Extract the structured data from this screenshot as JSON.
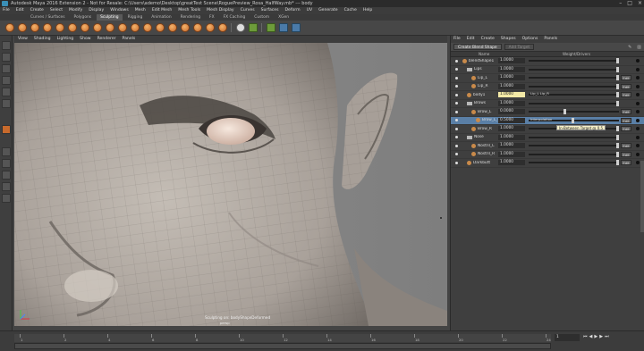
{
  "window": {
    "title": "Autodesk Maya 2016 Extension 2 - Not for Resale: C:\\Users\\ademo\\Desktop\\greatTest Scene\\RoguePreview_Rosa_HalfWay.mb* --- body"
  },
  "menubar": [
    "File",
    "Edit",
    "Create",
    "Select",
    "Modify",
    "Display",
    "Windows",
    "Mesh",
    "Edit Mesh",
    "Mesh Tools",
    "Mesh Display",
    "Curves",
    "Surfaces",
    "Deform",
    "UV",
    "Generate",
    "Cache",
    "Help"
  ],
  "shelf_tabs": {
    "items": [
      "Curves / Surfaces",
      "Polygons",
      "Sculpting",
      "Rigging",
      "Animation",
      "Rendering",
      "FX",
      "FX Caching",
      "Custom",
      "XGen"
    ],
    "active": "Sculpting"
  },
  "viewport": {
    "menu": [
      "View",
      "Shading",
      "Lighting",
      "Show",
      "Renderer",
      "Panels"
    ],
    "caption": "Sculpting on: bodyShapeDeformed",
    "camera": "persp"
  },
  "blend_panel": {
    "menu": [
      "File",
      "Edit",
      "Create",
      "Shapes",
      "Options",
      "Panels"
    ],
    "create_button": "Create Blend Shape",
    "add_target_button": "Add Target",
    "columns": [
      "Name",
      "Weight/Drivers"
    ],
    "edit_label": "Edit",
    "rows": [
      {
        "name": "blendShape1",
        "weight": "1.0000",
        "type": "node",
        "indent": 0,
        "fill": 1.0,
        "edit": false
      },
      {
        "name": "Lips",
        "weight": "1.0000",
        "type": "folder",
        "indent": 1,
        "fill": 1.0,
        "edit": false
      },
      {
        "name": "Lip_L",
        "weight": "1.0000",
        "type": "target",
        "indent": 2,
        "fill": 1.0,
        "edit": true
      },
      {
        "name": "Lip_R",
        "weight": "1.0000",
        "type": "target",
        "indent": 2,
        "fill": 1.0,
        "edit": true
      },
      {
        "name": "body1",
        "weight": "1.0000",
        "type": "target",
        "indent": 1,
        "fill": 1.0,
        "edit": true,
        "highlight": true,
        "extra": "Lip_L Lip_R"
      },
      {
        "name": "Brows",
        "weight": "1.0000",
        "type": "folder",
        "indent": 1,
        "fill": 1.0,
        "edit": false
      },
      {
        "name": "Brow_L",
        "weight": "0.0000",
        "type": "target",
        "indent": 2,
        "fill": 0.42,
        "edit": true
      },
      {
        "name": "Brow_L_0.5",
        "weight": "0.5000",
        "type": "target",
        "indent": 3,
        "fill": 0.5,
        "edit": true,
        "selected": true,
        "extra": "Interpolation"
      },
      {
        "name": "Brow_R",
        "weight": "1.0000",
        "type": "target",
        "indent": 2,
        "fill": 1.0,
        "edit": true
      },
      {
        "name": "Nose",
        "weight": "1.0000",
        "type": "folder",
        "indent": 1,
        "fill": 1.0,
        "edit": false
      },
      {
        "name": "Nostril_L",
        "weight": "1.0000",
        "type": "target",
        "indent": 2,
        "fill": 1.0,
        "edit": true
      },
      {
        "name": "Nostril_R",
        "weight": "1.0000",
        "type": "target",
        "indent": 2,
        "fill": 1.0,
        "edit": true
      },
      {
        "name": "Darkbutt",
        "weight": "1.0000",
        "type": "target",
        "indent": 1,
        "fill": 1.0,
        "edit": true
      }
    ],
    "tooltip": "In-Between Target @ 0.5"
  },
  "timeslider": {
    "ticks": [
      "1",
      "2",
      "4",
      "6",
      "8",
      "10",
      "12",
      "14",
      "16",
      "18",
      "20",
      "22",
      "24"
    ],
    "current_frame": "1"
  },
  "colors": {
    "skin": "#b9b2ab",
    "selection": "#5a7fa6",
    "accent": "#c86a2c"
  }
}
